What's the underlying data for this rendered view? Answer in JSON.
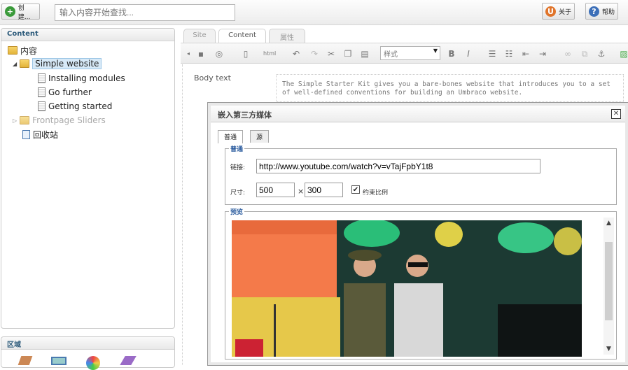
{
  "topbar": {
    "create_label": "创建...",
    "search_placeholder": "输入内容开始查找...",
    "about_label": "关于",
    "help_label": "帮助"
  },
  "content_panel": {
    "title": "Content",
    "root": "内容",
    "items": [
      {
        "label": "Simple website",
        "level": 1,
        "type": "folder",
        "selected": true
      },
      {
        "label": "Installing modules",
        "level": 2,
        "type": "doc"
      },
      {
        "label": "Go further",
        "level": 2,
        "type": "doc"
      },
      {
        "label": "Getting started",
        "level": 2,
        "type": "doc"
      },
      {
        "label": "Frontpage Sliders",
        "level": 1,
        "type": "folder",
        "disabled": true
      },
      {
        "label": "回收站",
        "level": 1,
        "type": "recycle"
      }
    ]
  },
  "sections_panel": {
    "title": "区域"
  },
  "editor": {
    "tabs": [
      "Site",
      "Content",
      "属性"
    ],
    "active_tab": "Content",
    "style_select": "样式",
    "field_label": "Body text",
    "body_text": "The Simple Starter Kit gives you a bare-bones website that introduces you to a set of well-defined conventions for building an Umbraco website."
  },
  "dialog": {
    "title": "嵌入第三方媒体",
    "tabs": [
      "普通",
      "源"
    ],
    "general_legend": "普通",
    "url_label": "链接:",
    "url_value": "http://www.youtube.com/watch?v=vTajFpbY1t8",
    "size_label": "尺寸:",
    "width_value": "500",
    "height_value": "300",
    "times": "×",
    "constrain_label": "约束比例",
    "constrain_checked": true,
    "preview_legend": "预览"
  },
  "colors": {
    "accent": "#2c5a7a",
    "selected_bg": "#d7e9f7",
    "legend": "#2f5fa0"
  }
}
